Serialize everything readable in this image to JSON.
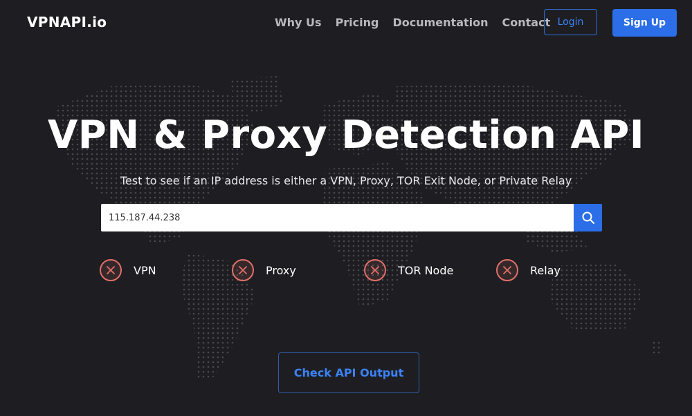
{
  "brand": {
    "logo_text": "VPNAPI.io"
  },
  "nav": {
    "links": [
      "Why Us",
      "Pricing",
      "Documentation",
      "Contact"
    ],
    "login_label": "Login",
    "signup_label": "Sign Up"
  },
  "hero": {
    "title": "VPN & Proxy Detection API",
    "subtitle": "Test to see if an IP address is either a VPN, Proxy, TOR Exit Node, or Private Relay"
  },
  "search": {
    "value": "115.187.44.238"
  },
  "results": [
    {
      "label": "VPN",
      "status": "negative"
    },
    {
      "label": "Proxy",
      "status": "negative"
    },
    {
      "label": "TOR Node",
      "status": "negative"
    },
    {
      "label": "Relay",
      "status": "negative"
    }
  ],
  "cta": {
    "label": "Check API Output"
  },
  "colors": {
    "background": "#1e1e22",
    "accent": "#2b6ee8",
    "negative": "#e2706a"
  },
  "icons": {
    "search": "search-icon",
    "result": "x-circle-icon"
  }
}
